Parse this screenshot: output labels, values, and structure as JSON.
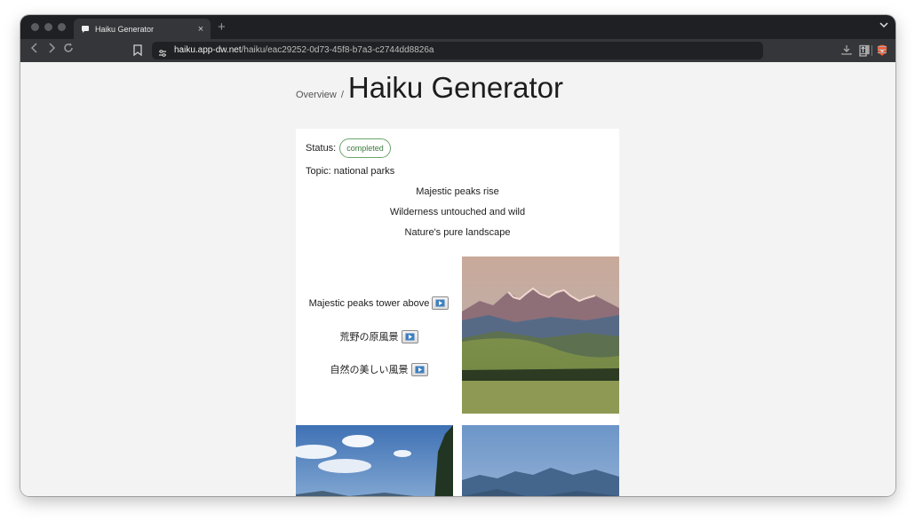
{
  "browser": {
    "tab_title": "Haiku Generator",
    "tab_close": "×",
    "new_tab": "+",
    "tab_menu": "⌄",
    "url_host": "haiku.app-dw.net",
    "url_path": "/haiku/eac29252-0d73-45f8-b7a3-c2744dd8826a"
  },
  "page": {
    "breadcrumb": "Overview",
    "breadcrumb_sep": "/",
    "title": "Haiku Generator"
  },
  "haiku": {
    "status_label": "Status:",
    "status": "completed",
    "topic_label": "Topic: national parks",
    "lines": [
      "Majestic peaks rise",
      "Wilderness untouched and wild",
      "Nature's pure landscape"
    ],
    "translations": [
      {
        "text": "Majestic peaks tower above"
      },
      {
        "text": "荒野の原風景"
      },
      {
        "text": "自然の美しい風景"
      }
    ]
  },
  "colors": {
    "badge_border": "#6aa56a",
    "badge_text": "#3a7a3a",
    "background": "#f3f3f3"
  }
}
